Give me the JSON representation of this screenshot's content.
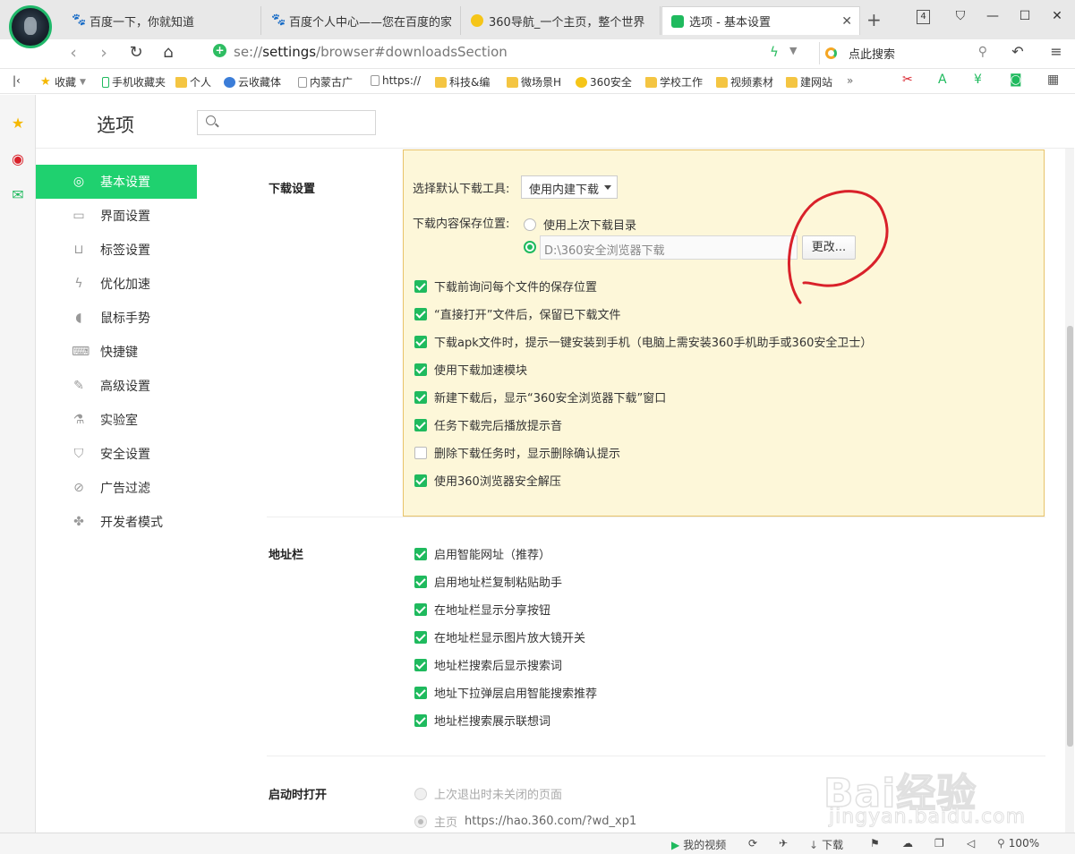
{
  "tabs": [
    {
      "label": "百度一下，你就知道",
      "icon": "baidu-paw-icon",
      "color": "#2d64e0"
    },
    {
      "label": "百度个人中心——您在百度的家",
      "icon": "baidu-paw-icon",
      "color": "#2d64e0"
    },
    {
      "label": "360导航_一个主页，整个世界",
      "icon": "360-logo-icon",
      "color": "#f5c518"
    },
    {
      "label": "选项 - 基本设置",
      "icon": "wrench-icon",
      "color": "#1fba5e"
    }
  ],
  "tab_count": "4",
  "address": {
    "prefix": "se://",
    "bold": "settings",
    "suffix": "/browser#downloadsSection"
  },
  "search_placeholder": "点此搜索",
  "bookmarks": [
    {
      "label": "收藏",
      "type": "star"
    },
    {
      "label": "手机收藏夹",
      "type": "phone"
    },
    {
      "label": "个人",
      "type": "folder"
    },
    {
      "label": "云收藏体",
      "type": "cloud"
    },
    {
      "label": "内蒙古广",
      "type": "page"
    },
    {
      "label": "https://",
      "type": "page"
    },
    {
      "label": "科技&编",
      "type": "folder"
    },
    {
      "label": "微场景H",
      "type": "folder"
    },
    {
      "label": "360安全",
      "type": "360"
    },
    {
      "label": "学校工作",
      "type": "folder"
    },
    {
      "label": "视频素材",
      "type": "folder"
    },
    {
      "label": "建网站",
      "type": "folder"
    }
  ],
  "page_title": "选项",
  "nav": [
    {
      "label": "基本设置",
      "icon": "gear-icon",
      "glyph": "◎",
      "active": true
    },
    {
      "label": "界面设置",
      "icon": "window-icon",
      "glyph": "▭"
    },
    {
      "label": "标签设置",
      "icon": "tab-icon",
      "glyph": "⊔"
    },
    {
      "label": "优化加速",
      "icon": "lightning-icon",
      "glyph": "ϟ"
    },
    {
      "label": "鼠标手势",
      "icon": "mouse-icon",
      "glyph": "◖"
    },
    {
      "label": "快捷键",
      "icon": "keyboard-icon",
      "glyph": "⌨"
    },
    {
      "label": "高级设置",
      "icon": "wrench-icon",
      "glyph": "✎"
    },
    {
      "label": "实验室",
      "icon": "flask-icon",
      "glyph": "⚗"
    },
    {
      "label": "安全设置",
      "icon": "shield-icon",
      "glyph": "⛉"
    },
    {
      "label": "广告过滤",
      "icon": "block-icon",
      "glyph": "⊘"
    },
    {
      "label": "开发者模式",
      "icon": "puzzle-icon",
      "glyph": "✤"
    }
  ],
  "download": {
    "section_label": "下载设置",
    "tool_label": "选择默认下载工具:",
    "tool_value": "使用内建下载",
    "location_label": "下载内容保存位置:",
    "radio_last": "使用上次下载目录",
    "path_value": "D:\\360安全浏览器下载",
    "change_btn": "更改...",
    "checks": [
      {
        "label": "下载前询问每个文件的保存位置",
        "checked": true
      },
      {
        "label": "“直接打开”文件后，保留已下载文件",
        "checked": true
      },
      {
        "label": "下载apk文件时，提示一键安装到手机（电脑上需安装360手机助手或360安全卫士）",
        "checked": true
      },
      {
        "label": "使用下载加速模块",
        "checked": true
      },
      {
        "label": "新建下载后，显示“360安全浏览器下载”窗口",
        "checked": true
      },
      {
        "label": "任务下载完后播放提示音",
        "checked": true
      },
      {
        "label": "删除下载任务时，显示删除确认提示",
        "checked": false
      },
      {
        "label": "使用360浏览器安全解压",
        "checked": true
      }
    ]
  },
  "addressbar": {
    "section_label": "地址栏",
    "checks": [
      {
        "label": "启用智能网址（推荐）",
        "checked": true
      },
      {
        "label": "启用地址栏复制粘贴助手",
        "checked": true
      },
      {
        "label": "在地址栏显示分享按钮",
        "checked": true
      },
      {
        "label": "在地址栏显示图片放大镜开关",
        "checked": true
      },
      {
        "label": "地址栏搜索后显示搜索词",
        "checked": true
      },
      {
        "label": "地址下拉弹层启用智能搜索推荐",
        "checked": true
      },
      {
        "label": "地址栏搜索展示联想词",
        "checked": true
      }
    ]
  },
  "startup": {
    "section_label": "启动时打开",
    "opt1": "上次退出时未关闭的页面",
    "opt2_label": "主页",
    "opt2_url": "https://hao.360.com/?wd_xp1"
  },
  "status": {
    "my_video": "我的视频",
    "download": "下载",
    "zoom": "100%"
  },
  "watermark": {
    "main": "Bai经验",
    "sub": "jingyan.baidu.com"
  },
  "colors": {
    "accent": "#1fd16f",
    "check": "#1fba5e",
    "highlight_bg": "#fdf7d9",
    "highlight_border": "#e8c36a",
    "annotation": "#d9212a"
  }
}
